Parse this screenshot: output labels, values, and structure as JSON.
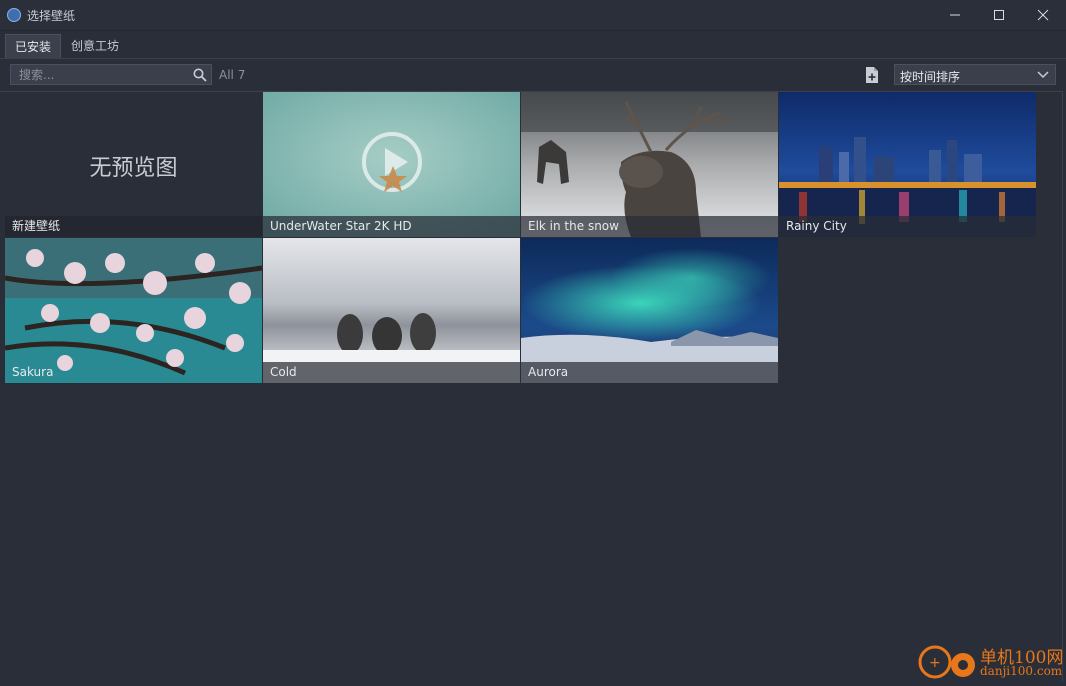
{
  "window": {
    "title": "选择壁纸"
  },
  "tabs": [
    {
      "label": "已安装",
      "active": true
    },
    {
      "label": "创意工坊",
      "active": false
    }
  ],
  "toolbar": {
    "search_placeholder": "搜索...",
    "count": "All 7",
    "sort_value": "按时间排序"
  },
  "wallpapers": [
    {
      "name": "新建壁纸",
      "preview_text": "无预览图"
    },
    {
      "name": "UnderWater Star 2K HD",
      "selected": true
    },
    {
      "name": "Elk in the snow"
    },
    {
      "name": "Rainy City"
    },
    {
      "name": "Sakura"
    },
    {
      "name": "Cold"
    },
    {
      "name": "Aurora"
    }
  ],
  "watermark": {
    "line1": "单机100网",
    "line2": "danji100.com"
  },
  "colors": {
    "accent": "#3a8be0",
    "background": "#2a2e38"
  }
}
